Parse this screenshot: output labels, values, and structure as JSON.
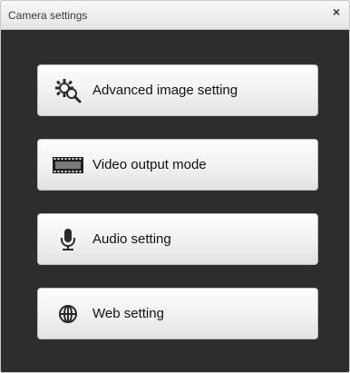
{
  "dialog": {
    "title": "Camera settings",
    "close_glyph": "×"
  },
  "menu": {
    "items": [
      {
        "label": "Advanced image setting",
        "icon": "gear-magnifier-icon"
      },
      {
        "label": "Video output mode",
        "icon": "film-strip-icon"
      },
      {
        "label": "Audio setting",
        "icon": "microphone-icon"
      },
      {
        "label": "Web setting",
        "icon": "globe-icon"
      }
    ]
  }
}
